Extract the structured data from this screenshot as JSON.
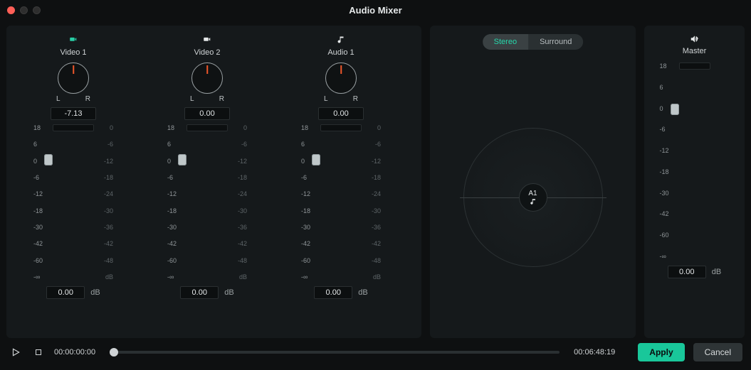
{
  "window": {
    "title": "Audio Mixer"
  },
  "scale_left": [
    "18",
    "6",
    "0",
    "-6",
    "-12",
    "-18",
    "-30",
    "-42",
    "-60",
    "-∞"
  ],
  "scale_right": [
    "0",
    "-6",
    "-12",
    "-18",
    "-24",
    "-30",
    "-36",
    "-42",
    "-48",
    "dB"
  ],
  "scale_master_left": [
    "18",
    "6",
    "0",
    "-6",
    "-12",
    "-18",
    "-30",
    "-42",
    "-60",
    "-∞"
  ],
  "scale_master_right": [
    "",
    "",
    "",
    "",
    "",
    "",
    "",
    "",
    "",
    ""
  ],
  "pan": {
    "left_label": "L",
    "right_label": "R"
  },
  "tracks": [
    {
      "name": "Video  1",
      "icon": "video-icon",
      "icon_class": "",
      "pan_value": "-7.13",
      "fader_value": "0.00",
      "fader_unit": "dB"
    },
    {
      "name": "Video  2",
      "icon": "video-icon",
      "icon_class": "white",
      "pan_value": "0.00",
      "fader_value": "0.00",
      "fader_unit": "dB"
    },
    {
      "name": "Audio  1",
      "icon": "music-icon",
      "icon_class": "white",
      "pan_value": "0.00",
      "fader_value": "0.00",
      "fader_unit": "dB"
    }
  ],
  "spatial": {
    "modes": {
      "stereo": "Stereo",
      "surround": "Surround",
      "active": "stereo"
    },
    "node_label": "A1"
  },
  "master": {
    "label": "Master",
    "fader_value": "0.00",
    "fader_unit": "dB"
  },
  "transport": {
    "current_time": "00:00:00:00",
    "total_time": "00:06:48:19"
  },
  "buttons": {
    "apply": "Apply",
    "cancel": "Cancel"
  }
}
